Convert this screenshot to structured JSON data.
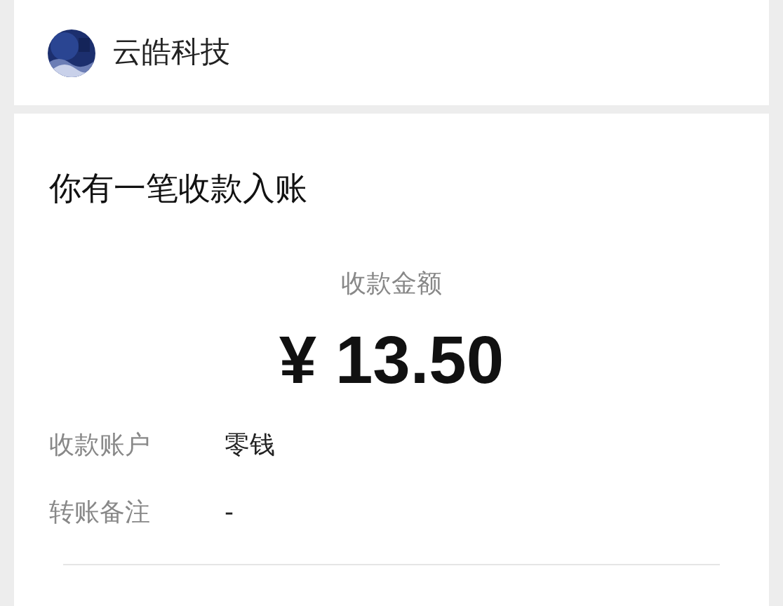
{
  "account": {
    "name": "云皓科技"
  },
  "message": {
    "title": "你有一笔收款入账",
    "amount_label": "收款金额",
    "amount": "¥ 13.50",
    "details": [
      {
        "label": "收款账户",
        "value": "零钱"
      },
      {
        "label": "转账备注",
        "value": "-"
      }
    ]
  }
}
